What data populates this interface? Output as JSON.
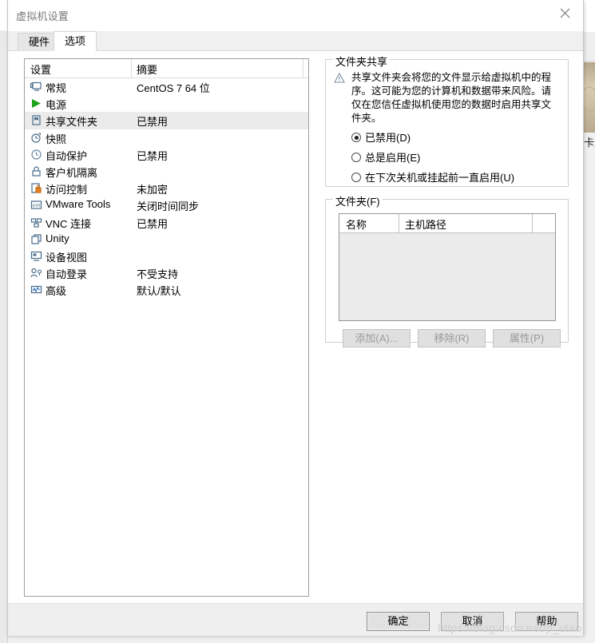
{
  "window": {
    "title": "虚拟机设置",
    "close_icon": "close-icon"
  },
  "tabs": [
    {
      "label": "硬件",
      "active": false
    },
    {
      "label": "选项",
      "active": true
    }
  ],
  "settings_list": {
    "headers": {
      "setting": "设置",
      "summary": "摘要"
    },
    "rows": [
      {
        "icon": "monitor-icon",
        "label": "常规",
        "summary": "CentOS 7 64 位",
        "selected": false
      },
      {
        "icon": "play-icon",
        "label": "电源",
        "summary": "",
        "selected": false
      },
      {
        "icon": "shared-folder-icon",
        "label": "共享文件夹",
        "summary": "已禁用",
        "selected": true
      },
      {
        "icon": "snapshot-icon",
        "label": "快照",
        "summary": "",
        "selected": false
      },
      {
        "icon": "clock-icon",
        "label": "自动保护",
        "summary": "已禁用",
        "selected": false
      },
      {
        "icon": "lock-icon",
        "label": "客户机隔离",
        "summary": "",
        "selected": false
      },
      {
        "icon": "access-control-icon",
        "label": "访问控制",
        "summary": "未加密",
        "selected": false
      },
      {
        "icon": "vmware-tools-icon",
        "label": "VMware Tools",
        "summary": "关闭时间同步",
        "selected": false
      },
      {
        "icon": "vnc-icon",
        "label": "VNC 连接",
        "summary": "已禁用",
        "selected": false
      },
      {
        "icon": "unity-icon",
        "label": "Unity",
        "summary": "",
        "selected": false
      },
      {
        "icon": "device-view-icon",
        "label": "设备视图",
        "summary": "",
        "selected": false
      },
      {
        "icon": "autologin-icon",
        "label": "自动登录",
        "summary": "不受支持",
        "selected": false
      },
      {
        "icon": "advanced-icon",
        "label": "高级",
        "summary": "默认/默认",
        "selected": false
      }
    ]
  },
  "folder_sharing": {
    "group_title": "文件夹共享",
    "warning_icon": "warning-triangle-icon",
    "warning_text": "共享文件夹会将您的文件显示给虚拟机中的程序。这可能为您的计算机和数据带来风险。请仅在您信任虚拟机使用您的数据时启用共享文件夹。",
    "options": [
      {
        "label": "已禁用(D)",
        "checked": true
      },
      {
        "label": "总是启用(E)",
        "checked": false
      },
      {
        "label": "在下次关机或挂起前一直启用(U)",
        "checked": false
      }
    ]
  },
  "folders": {
    "group_title": "文件夹(F)",
    "columns": [
      "名称",
      "主机路径",
      ""
    ],
    "rows": [],
    "buttons": [
      {
        "label": "添加(A)...",
        "enabled": false
      },
      {
        "label": "移除(R)",
        "enabled": false
      },
      {
        "label": "属性(P)",
        "enabled": false
      }
    ]
  },
  "dialog_buttons": {
    "ok": "确定",
    "cancel": "取消",
    "help": "帮助"
  },
  "watermark": "https://blog.csdn.net/p_utao",
  "background": {
    "right_glyph": "卡片"
  },
  "colors": {
    "selection": "#ebebeb",
    "dialog_bg": "#f0f0f0",
    "panel_bg": "#ffffff",
    "disabled_text": "#9a9a9a",
    "title_text": "#7a7a7a"
  }
}
